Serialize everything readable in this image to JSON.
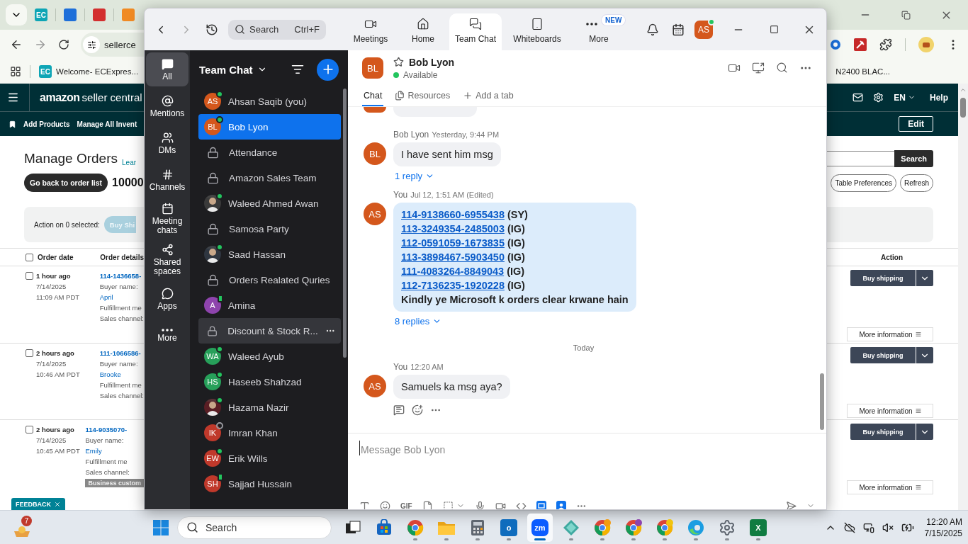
{
  "browser": {
    "tabs": [
      {
        "kind": "ec",
        "glyph": "EC"
      },
      {
        "kind": "blue"
      },
      {
        "kind": "red"
      },
      {
        "kind": "orange"
      }
    ],
    "address": "sellerce",
    "bookmarks": [
      {
        "glyph": "EC",
        "label": "Welcome- ECExpres..."
      }
    ],
    "bookmark_right": "N2400 BLAC..."
  },
  "amazon": {
    "brand": "amazon",
    "product": "seller central",
    "language": "EN",
    "help": "Help",
    "subnav": [
      "Add Products",
      "Manage All Invent"
    ],
    "edit": "Edit",
    "title": "Manage Orders",
    "learn": "Lear",
    "back_button": "Go back to order list",
    "order_number": "10000",
    "search_button": "Search",
    "table_preferences": "Table Preferences",
    "refresh": "Refresh",
    "action_label": "Action on 0 selected:",
    "action_button": "Buy Shi",
    "header_checked": false,
    "columns": [
      "Order date",
      "Order details",
      "Action"
    ],
    "rows": [
      {
        "checked": false,
        "age": "1 hour ago",
        "date": "7/14/2025",
        "time": "11:09 AM PDT",
        "order": "114-1436658-",
        "buyer_label": "Buyer name:",
        "buyer": "April",
        "fulfillment": "Fulfillment me",
        "sales": "Sales channel:",
        "action": "Buy shipping",
        "more": "More information"
      },
      {
        "checked": false,
        "age": "2 hours ago",
        "date": "7/14/2025",
        "time": "10:46 AM PDT",
        "order": "111-1066586-",
        "buyer_label": "Buyer name:",
        "buyer": "Brooke",
        "fulfillment": "Fulfillment me",
        "sales": "Sales channel:",
        "action": "Buy shipping",
        "more": "More information"
      },
      {
        "checked": false,
        "age": "2 hours ago",
        "date": "7/14/2025",
        "time": "10:45 AM PDT",
        "order": "114-9035070-",
        "buyer_label": "Buyer name:",
        "buyer": "Emily",
        "fulfillment": "Fulfillment me",
        "sales": "Sales channel:",
        "badge": "Business custom",
        "action": "Buy shipping",
        "more": "More information"
      }
    ],
    "feedback": "FEEDBACK"
  },
  "zoom": {
    "search": {
      "placeholder": "Search",
      "shortcut": "Ctrl+F"
    },
    "nav": [
      {
        "kind": "meetings",
        "label": "Meetings",
        "selected": false
      },
      {
        "kind": "home",
        "label": "Home",
        "selected": false
      },
      {
        "kind": "chat",
        "label": "Team Chat",
        "selected": true
      },
      {
        "kind": "whiteboards",
        "label": "Whiteboards",
        "selected": false
      },
      {
        "kind": "more",
        "label": "More",
        "selected": false,
        "badge": "NEW"
      }
    ],
    "user": {
      "initials": "AS",
      "color": "#d4571c",
      "online": true
    },
    "rail": [
      {
        "kind": "all",
        "label": "All",
        "selected": true
      },
      {
        "kind": "mentions",
        "label": "Mentions",
        "selected": false
      },
      {
        "kind": "dms",
        "label": "DMs",
        "selected": false
      },
      {
        "kind": "channels",
        "label": "Channels",
        "selected": false
      },
      {
        "kind": "meeting_chats",
        "label": "Meeting chats",
        "selected": false
      },
      {
        "kind": "shared",
        "label": "Shared spaces",
        "selected": false
      },
      {
        "kind": "apps",
        "label": "Apps",
        "selected": false
      },
      {
        "kind": "more",
        "label": "More",
        "selected": false
      }
    ],
    "list_title": "Team Chat",
    "chats": [
      {
        "kind": "avatar",
        "name": "Ahsan Saqib (you)",
        "initials": "AS",
        "color": "#d4571c",
        "online": true,
        "mobile": false,
        "selected": false,
        "hovered": false
      },
      {
        "kind": "avatar",
        "name": "Bob Lyon",
        "initials": "BL",
        "color": "#d4571c",
        "online": true,
        "mobile": false,
        "selected": true,
        "hovered": false
      },
      {
        "kind": "channel",
        "name": "Attendance",
        "selected": false,
        "hovered": false
      },
      {
        "kind": "channel",
        "name": "Amazon Sales Team",
        "selected": false,
        "hovered": false
      },
      {
        "name": "Waleed Ahmed Awan",
        "color": "#3a3a3a",
        "online": true,
        "mobile": false,
        "selected": false,
        "hovered": false
      },
      {
        "kind": "channel",
        "name": "Samosa Party",
        "selected": false,
        "hovered": false
      },
      {
        "name": "Saad Hassan",
        "color": "#2f3640",
        "online": true,
        "mobile": false,
        "selected": false,
        "hovered": false
      },
      {
        "kind": "channel",
        "name": "Orders Realated Quries",
        "selected": false,
        "hovered": false
      },
      {
        "kind": "avatar",
        "name": "Amina",
        "initials": "A",
        "color": "#8e44ad",
        "online": true,
        "mobile": true,
        "selected": false,
        "hovered": false
      },
      {
        "kind": "channel",
        "name": "Discount & Stock R...",
        "selected": false,
        "hovered": true
      },
      {
        "kind": "avatar",
        "name": "Waleed Ayub",
        "initials": "WA",
        "color": "#27a05a",
        "online": true,
        "mobile": false,
        "selected": false,
        "hovered": false
      },
      {
        "kind": "avatar",
        "name": "Haseeb Shahzad",
        "initials": "HS",
        "color": "#27a05a",
        "online": true,
        "mobile": false,
        "selected": false,
        "hovered": false
      },
      {
        "name": "Hazama Nazir",
        "color": "#5a1e24",
        "online": true,
        "mobile": false,
        "selected": false,
        "hovered": false
      },
      {
        "kind": "avatar",
        "name": "Imran Khan",
        "initials": "IK",
        "color": "#c0392b",
        "online": false,
        "selected": false,
        "hovered": false
      },
      {
        "kind": "avatar",
        "name": "Erik Wills",
        "initials": "EW",
        "color": "#c0392b",
        "online": true,
        "mobile": false,
        "selected": false,
        "hovered": false
      },
      {
        "kind": "avatar",
        "name": "Sajjad Hussain",
        "initials": "SH",
        "color": "#c0392b",
        "online": true,
        "mobile": true,
        "selected": false,
        "hovered": false
      }
    ],
    "conversation": {
      "name": "Bob Lyon",
      "initials": "BL",
      "color": "#d4571c",
      "status": "Available",
      "starred": false,
      "tabs": [
        {
          "kind": "chat",
          "label": "Chat",
          "selected": true
        },
        {
          "kind": "resources",
          "label": "Resources",
          "selected": false
        },
        {
          "kind": "add",
          "label": "Add a tab",
          "selected": false
        }
      ],
      "messages": [
        {
          "kind": "clipped",
          "color": "#d4571c"
        },
        {
          "kind": "text",
          "sender": "Bob Lyon",
          "time": "Yesterday, 9:44 PM",
          "initials": "BL",
          "color": "#d4571c",
          "text": "I have sent him msg",
          "replies": "1 reply"
        },
        {
          "kind": "orders",
          "sender": "You",
          "time": "Jul 12, 1:51 AM (Edited)",
          "initials": "AS",
          "color": "#d4571c",
          "lines": [
            {
              "order": "114-9138660-6955438",
              "tag": "(SY)"
            },
            {
              "order": "113-3249354-2485003",
              "tag": "(IG)"
            },
            {
              "order": "112-0591059-1673835",
              "tag": "(IG)"
            },
            {
              "order": "113-3898467-5903450",
              "tag": "(IG)"
            },
            {
              "order": "111-4083264-8849043",
              "tag": "(IG)"
            },
            {
              "order": "112-7136235-1920228",
              "tag": "(IG)"
            }
          ],
          "note": "Kindly ye Microsoft k orders clear krwane hain",
          "replies": "8 replies"
        },
        {
          "kind": "divider",
          "label": "Today"
        },
        {
          "kind": "text",
          "sender": "You",
          "time": "12:20 AM",
          "initials": "AS",
          "color": "#d4571c",
          "text": "Samuels ka msg aya?",
          "actions": true
        }
      ],
      "composer": {
        "placeholder": "Message Bob Lyon",
        "gif": "GIF"
      }
    }
  },
  "taskbar": {
    "weather_badge": "7",
    "search": "Search",
    "apps": [
      {
        "kind": "taskview",
        "running": false,
        "active": false
      },
      {
        "kind": "store",
        "running": false,
        "active": false
      },
      {
        "kind": "chrome",
        "running": true,
        "active": false
      },
      {
        "kind": "explorer",
        "running": true,
        "active": false
      },
      {
        "kind": "calculator",
        "running": true,
        "active": false
      },
      {
        "kind": "outlook",
        "glyph": "o",
        "running": true,
        "active": false
      },
      {
        "kind": "zoom",
        "glyph": "zm",
        "running": true,
        "active": true
      },
      {
        "kind": "gem",
        "running": true,
        "active": false
      },
      {
        "kind": "chrome_profile",
        "color": "#f39c12",
        "running": true,
        "active": false
      },
      {
        "kind": "chrome_profile",
        "color": "#8e44ad",
        "running": true,
        "active": false
      },
      {
        "kind": "chrome_profile",
        "color": "#f1c40f",
        "running": true,
        "active": false
      },
      {
        "kind": "edge",
        "running": true,
        "active": false
      },
      {
        "kind": "settings",
        "running": true,
        "active": false
      },
      {
        "kind": "excel",
        "glyph": "X",
        "running": true,
        "active": false
      }
    ],
    "time": "12:20 AM",
    "date": "7/15/2025"
  }
}
